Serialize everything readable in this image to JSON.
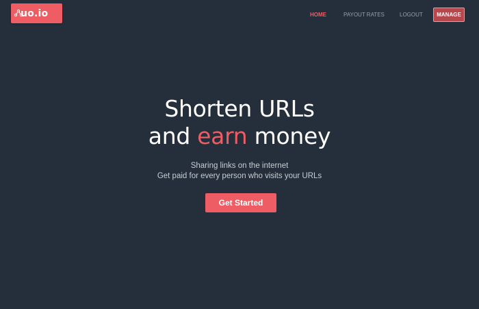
{
  "brand": {
    "logo_text": "uo.io",
    "accent_color": "#ee5d63"
  },
  "nav": {
    "items": [
      {
        "label": "HOME",
        "active": true
      },
      {
        "label": "PAYOUT RATES",
        "active": false
      },
      {
        "label": "LOGOUT",
        "active": false
      }
    ],
    "manage_label": "MANAGE"
  },
  "hero": {
    "title_line1": "Shorten URLs",
    "title_line2_pre": "and ",
    "title_line2_accent": "earn",
    "title_line2_post": " money",
    "subtitle_line1": "Sharing links on the internet",
    "subtitle_line2": "Get paid for every person who visits your URLs",
    "cta_label": "Get Started"
  },
  "colors": {
    "background": "#252f3b",
    "accent": "#ee5d63",
    "nav_text": "#98a0aa",
    "manage_bg": "#b6474c"
  },
  "icons": {
    "logo_mark": "network-nodes-icon"
  }
}
